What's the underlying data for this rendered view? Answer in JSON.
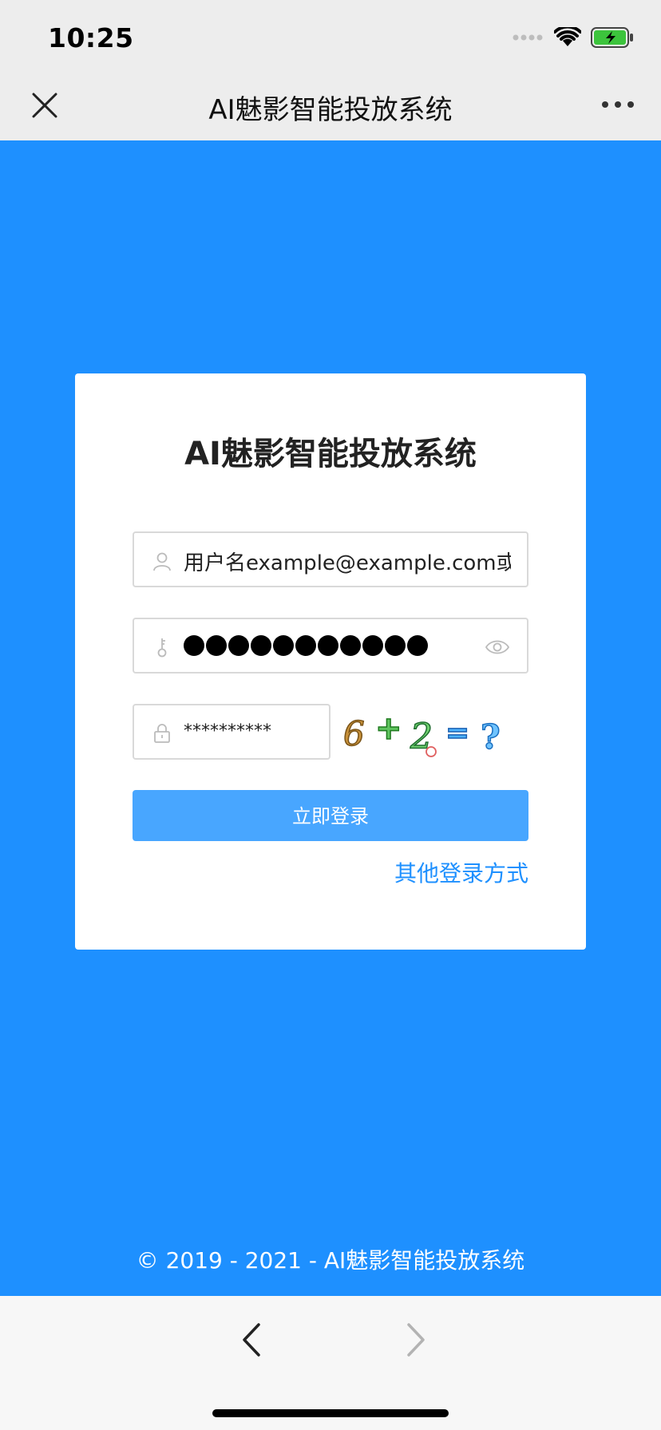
{
  "status": {
    "time": "10:25"
  },
  "nav": {
    "title": "AI魅影智能投放系统"
  },
  "card": {
    "title": "AI魅影智能投放系统",
    "username_value": "用户名example@example.com或",
    "password_dots": 11,
    "captcha_value": "**********",
    "captcha_text": "6+2=?",
    "login_label": "立即登录",
    "other_login_label": "其他登录方式"
  },
  "footer": {
    "copyright": "© 2019 - 2021 - AI魅影智能投放系统"
  },
  "colors": {
    "brand": "#1e90ff",
    "button": "#48a6ff"
  }
}
